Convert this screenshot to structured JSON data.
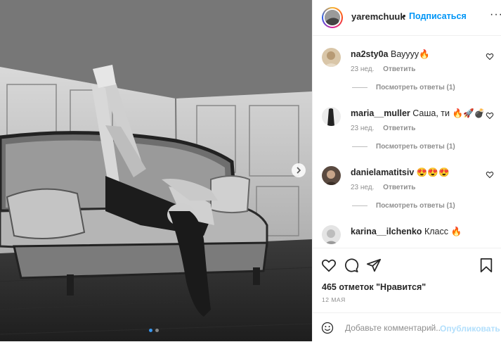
{
  "post": {
    "author": "yaremchuuk",
    "separator": "•",
    "follow_label": "Подписаться",
    "more_label": "···",
    "likes_text": "465 отметок \"Нравится\"",
    "date_text": "12 МАЯ",
    "carousel": {
      "slide_count": 2,
      "active_index": 0
    }
  },
  "comments": [
    {
      "user": "na2sty0a",
      "text": "Вауууу🔥",
      "age": "23 нед.",
      "reply": "Ответить",
      "view_replies": "Посмотреть ответы (1)"
    },
    {
      "user": "maria__muller",
      "text": "Саша, ти 🔥🚀💣",
      "age": "23 нед.",
      "reply": "Ответить",
      "view_replies": "Посмотреть ответы (1)"
    },
    {
      "user": "danielamatitsiv",
      "text": "😍😍😍",
      "age": "23 нед.",
      "reply": "Ответить",
      "view_replies": "Посмотреть ответы (1)"
    },
    {
      "user": "karina__ilchenko",
      "text": "Класс 🔥",
      "age": "",
      "reply": "",
      "view_replies": ""
    }
  ],
  "composer": {
    "placeholder": "Добавьте комментарий...",
    "post_label": "Опубликовать"
  },
  "icons": {
    "like": "heart-icon",
    "comment": "comment-icon",
    "share": "share-icon",
    "save": "bookmark-icon",
    "emoji": "emoji-icon",
    "next": "chevron-right-icon"
  },
  "colors": {
    "link": "#0095f6",
    "text": "#262626",
    "muted": "#8e8e8e",
    "post_disabled": "#b2dffc"
  }
}
